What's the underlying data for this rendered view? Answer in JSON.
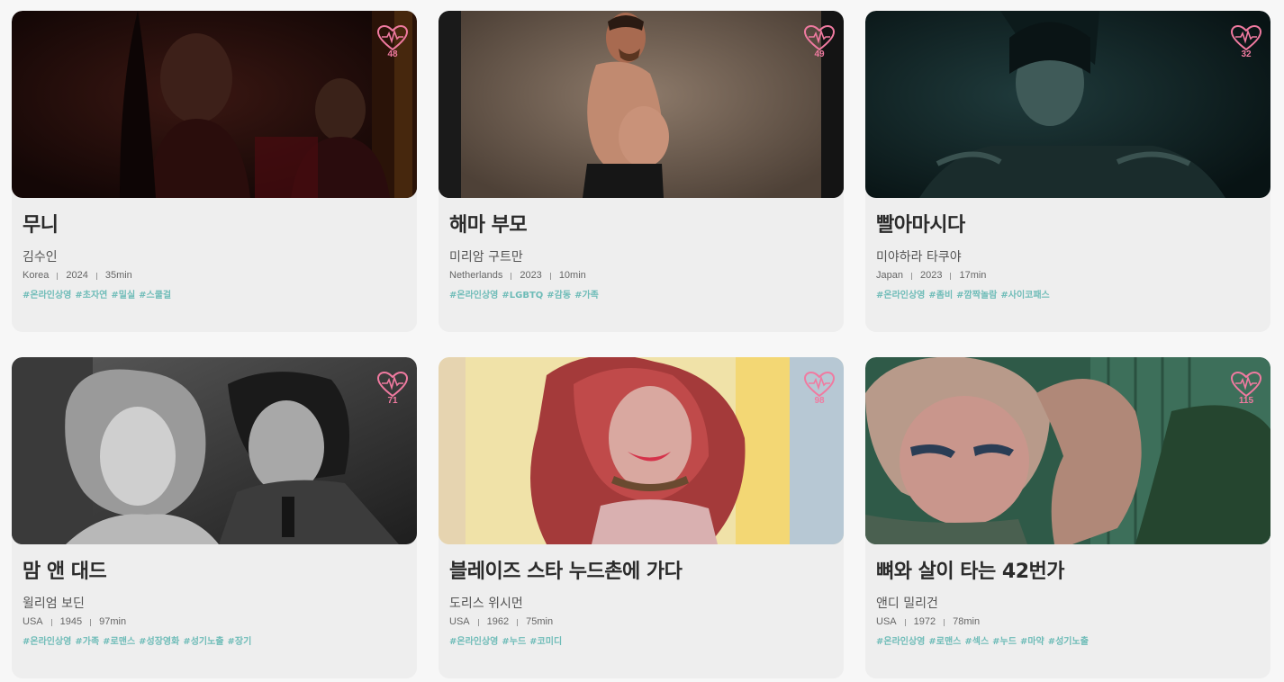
{
  "films": [
    {
      "title": "무니",
      "director": "김수인",
      "country": "Korea",
      "year": "2024",
      "runtime": "35min",
      "likes": "48",
      "tags": [
        "#온라인상영",
        "#초자연",
        "#밀실",
        "#스쿨걸"
      ]
    },
    {
      "title": "해마 부모",
      "director": "미리암 구트만",
      "country": "Netherlands",
      "year": "2023",
      "runtime": "10min",
      "likes": "49",
      "tags": [
        "#온라인상영",
        "#LGBTQ",
        "#감동",
        "#가족"
      ]
    },
    {
      "title": "빨아마시다",
      "director": "미야하라 타쿠야",
      "country": "Japan",
      "year": "2023",
      "runtime": "17min",
      "likes": "32",
      "tags": [
        "#온라인상영",
        "#좀비",
        "#깜짝놀람",
        "#사이코패스"
      ]
    },
    {
      "title": "맘 앤 대드",
      "director": "윌리엄 보딘",
      "country": "USA",
      "year": "1945",
      "runtime": "97min",
      "likes": "71",
      "tags": [
        "#온라인상영",
        "#가족",
        "#로맨스",
        "#성장영화",
        "#성기노출",
        "#장기"
      ]
    },
    {
      "title": "블레이즈 스타 누드촌에 가다",
      "director": "도리스 위시먼",
      "country": "USA",
      "year": "1962",
      "runtime": "75min",
      "likes": "98",
      "tags": [
        "#온라인상영",
        "#누드",
        "#코미디"
      ]
    },
    {
      "title": "뼈와 살이 타는 42번가",
      "director": "앤디 밀리건",
      "country": "USA",
      "year": "1972",
      "runtime": "78min",
      "likes": "115",
      "tags": [
        "#온라인상영",
        "#로맨스",
        "#섹스",
        "#누드",
        "#마약",
        "#성기노출"
      ]
    }
  ],
  "theme": {
    "accent_tag": "#6fbcb8",
    "heart_color": "#f07aa0",
    "card_bg": "#eeeeee"
  }
}
